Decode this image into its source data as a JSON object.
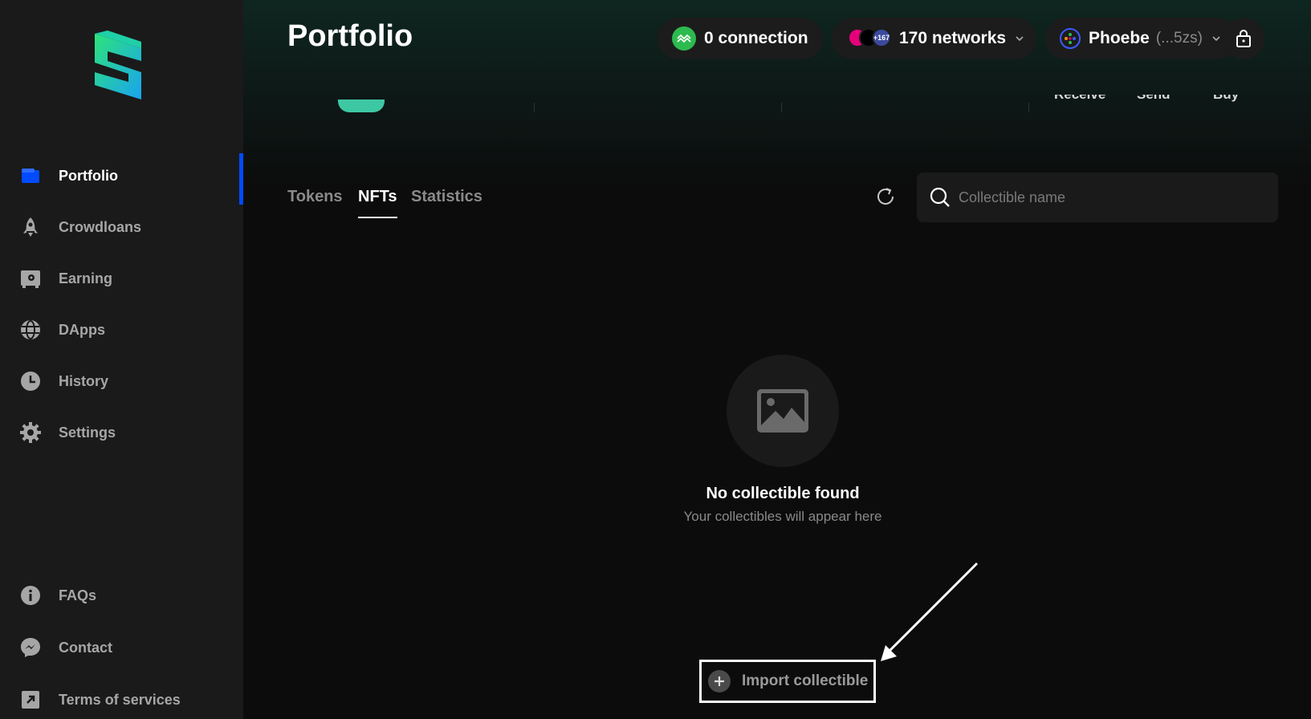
{
  "sidebar": {
    "items": [
      {
        "label": "Portfolio",
        "icon": "wallet-icon"
      },
      {
        "label": "Crowdloans",
        "icon": "rocket-icon"
      },
      {
        "label": "Earning",
        "icon": "safe-icon"
      },
      {
        "label": "DApps",
        "icon": "globe-icon"
      },
      {
        "label": "History",
        "icon": "clock-icon"
      },
      {
        "label": "Settings",
        "icon": "gear-icon"
      }
    ],
    "bottom_items": [
      {
        "label": "FAQs",
        "icon": "info-icon"
      },
      {
        "label": "Contact",
        "icon": "messenger-icon"
      },
      {
        "label": "Terms of services",
        "icon": "external-link-icon"
      }
    ],
    "active": "Portfolio"
  },
  "header": {
    "title": "Portfolio",
    "connection_label": "0 connection",
    "networks_label": "170 networks",
    "networks_badge": "+167",
    "account_name": "Phoebe",
    "account_short": "(...5zs)"
  },
  "actions": {
    "receive": "Receive",
    "send": "Send",
    "buy": "Buy"
  },
  "tabs": [
    {
      "label": "Tokens"
    },
    {
      "label": "NFTs"
    },
    {
      "label": "Statistics"
    }
  ],
  "active_tab": "NFTs",
  "search": {
    "placeholder": "Collectible name",
    "value": ""
  },
  "empty_state": {
    "title": "No collectible found",
    "subtitle": "Your collectibles will appear here"
  },
  "import_button": {
    "label": "Import collectible"
  },
  "colors": {
    "accent_blue": "#004bff",
    "connection_green": "#2dba4e",
    "brand_teal": "#3ec7a3"
  }
}
